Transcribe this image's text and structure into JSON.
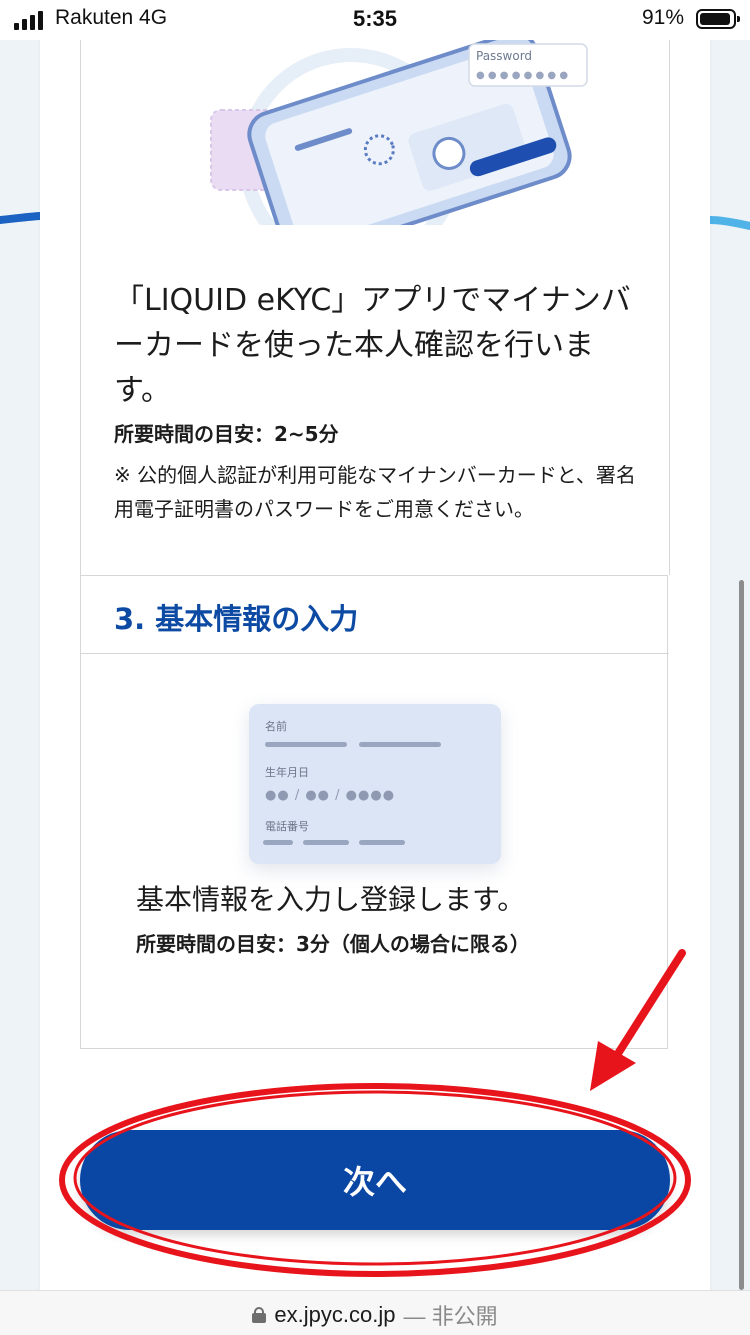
{
  "status_bar": {
    "carrier": "Rakuten  4G",
    "time": "5:35",
    "battery_percent": "91%",
    "battery_level": 0.91
  },
  "illustration_phone": {
    "password_label": "Password",
    "password_mask": "● ● ● ● ● ● ● ●"
  },
  "step2": {
    "description": "「LIQUID eKYC」アプリでマイナンバーカードを使った本人確認を行います。",
    "time_estimate": "所要時間の目安：2~5分",
    "note": "※ 公的個人認証が利用可能なマイナンバーカードと、署名用電子証明書のパスワードをご用意ください。"
  },
  "step3": {
    "title": "3. 基本情報の入力",
    "form_illustration": {
      "name_label": "名前",
      "birthdate_label": "生年月日",
      "birthdate_mask": "●● / ●● / ●●●●",
      "phone_label": "電話番号"
    },
    "description": "基本情報を入力し登録します。",
    "time_estimate": "所要時間の目安：3分（個人の場合に限る）"
  },
  "next_button": {
    "label": "次へ"
  },
  "url_bar": {
    "domain": "ex.jpyc.co.jp",
    "visibility": "— 非公開"
  },
  "colors": {
    "primary_blue": "#0a47a4",
    "annotation_red": "#e8141c",
    "background": "#eef3f8"
  }
}
